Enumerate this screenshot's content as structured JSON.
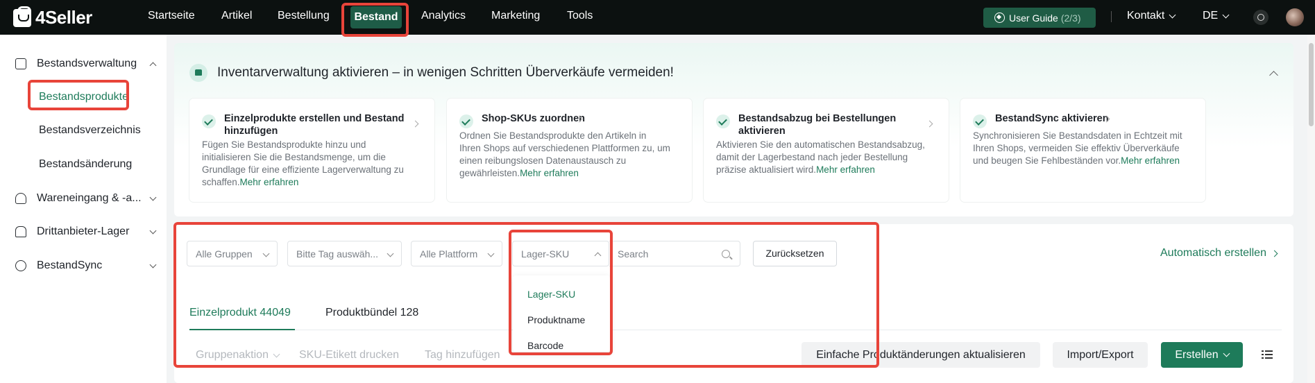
{
  "app": {
    "logo_text": "4Seller"
  },
  "nav": {
    "items": [
      "Startseite",
      "Artikel",
      "Bestellung",
      "Bestand",
      "Analytics",
      "Marketing",
      "Tools"
    ],
    "active": "Bestand",
    "user_guide_label": "User Guide",
    "user_guide_count": "(2/3)",
    "contact_label": "Kontakt",
    "language": "DE"
  },
  "sidebar": {
    "groups": [
      {
        "label": "Bestandsverwaltung",
        "icon": "inventory-icon",
        "expanded": true
      },
      {
        "label": "Wareneingang & -a...",
        "icon": "inbound-icon",
        "expanded": false
      },
      {
        "label": "Drittanbieter-Lager",
        "icon": "warehouse-icon",
        "expanded": false
      },
      {
        "label": "BestandSync",
        "icon": "sync-icon",
        "expanded": false
      }
    ],
    "sub_items": [
      "Bestandsprodukte",
      "Bestandsverzeichnis",
      "Bestandsänderung"
    ],
    "active_sub": "Bestandsprodukte"
  },
  "banner": {
    "title": "Inventarverwaltung aktivieren – in wenigen Schritten Überverkäufe vermeiden!",
    "link_label": "Mehr erfahren",
    "steps": [
      {
        "title_line1": "Einzelprodukte erstellen und Bestand",
        "title_line2": "hinzufügen",
        "desc": [
          "Fügen Sie Bestandsprodukte hinzu und",
          "initialisieren Sie die Bestandsmenge, um die",
          "Grundlage für eine effiziente Lagerverwaltung zu",
          "schaffen."
        ]
      },
      {
        "title_line1": "Shop-SKUs zuordnen",
        "title_line2": "",
        "desc": [
          "Ordnen Sie Bestandsprodukte den Artikeln in",
          "Ihren Shops auf verschiedenen Plattformen zu, um",
          "einen reibungslosen Datenaustausch zu",
          "gewährleisten."
        ]
      },
      {
        "title_line1": "Bestandsabzug bei Bestellungen",
        "title_line2": "aktivieren",
        "desc": [
          "Aktivieren Sie den automatischen Bestandsabzug,",
          "damit der Lagerbestand nach jeder Bestellung",
          "präzise aktualisiert wird."
        ]
      },
      {
        "title_line1": "BestandSync aktivieren",
        "title_line2": "",
        "desc": [
          "Synchronisieren Sie Bestandsdaten in Echtzeit mit",
          "Ihren Shops, vermeiden Sie effektiv Überverkäufe",
          "und beugen Sie Fehlbeständen vor."
        ]
      }
    ]
  },
  "filters": {
    "group": "Alle Gruppen",
    "tag": "Bitte Tag auswäh...",
    "platform": "Alle Plattform",
    "search_field": "Lager-SKU",
    "search_placeholder": "Search",
    "reset_label": "Zurücksetzen",
    "auto_create_label": "Automatisch erstellen",
    "dropdown_options": [
      "Lager-SKU",
      "Produktname",
      "Barcode"
    ],
    "dropdown_selected": "Lager-SKU"
  },
  "tabs": {
    "single_label": "Einzelprodukt 44049",
    "bundle_label": "Produktbündel 128"
  },
  "actions": {
    "group_action": "Gruppenaktion",
    "print_sku": "SKU-Etikett drucken",
    "add_tag": "Tag hinzufügen",
    "simple_update": "Einfache Produktänderungen aktualisieren",
    "import_export": "Import/Export",
    "create": "Erstellen"
  },
  "colors": {
    "brand_green": "#1e7b5a",
    "topbar": "#0c1110",
    "highlight_red": "#e8443a"
  }
}
